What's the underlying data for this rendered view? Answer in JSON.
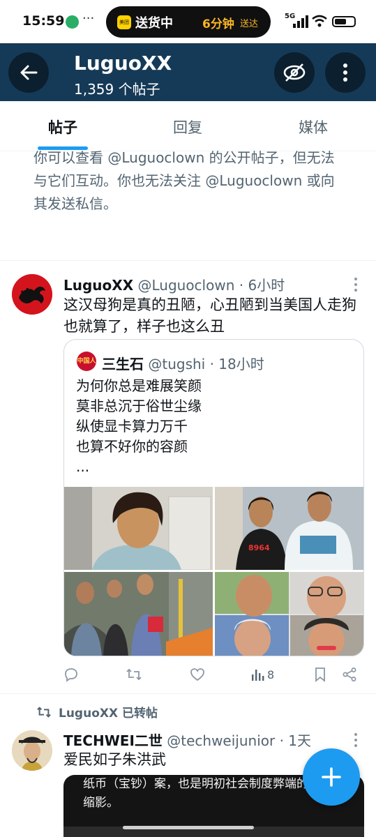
{
  "status_bar": {
    "time": "15:59",
    "dots": "···",
    "pill_app_icon": "美团",
    "pill_title": "送货中",
    "pill_eta": "6分钟",
    "pill_eta_suffix": "送达",
    "network": "5G"
  },
  "header": {
    "title": "LuguoXX",
    "subtitle": "1,359 个帖子"
  },
  "tabs": [
    {
      "label": "帖子",
      "active": true
    },
    {
      "label": "回复",
      "active": false
    },
    {
      "label": "媒体",
      "active": false
    }
  ],
  "notice": {
    "text": "你可以查看 @Luguoclown 的公开帖子，但无法与它们互动。你也无法关注 @Luguoclown 或向其发送私信。"
  },
  "tweet1": {
    "name": "LuguoXX",
    "handle": "@Luguoclown",
    "time": "· 6小时",
    "text": "这汉母狗是真的丑陋，心丑陋到当美国人走狗也就算了，样子也这么丑",
    "quote": {
      "avatar_text": "中国人",
      "name": "三生石",
      "handle": "@tugshi",
      "time": "· 18小时",
      "lines": [
        "为何你总是难展笑颜",
        "莫非总沉于俗世尘缘",
        "纵使显卡算力万千",
        "也算不好你的容颜",
        "..."
      ],
      "shirt_text": "8964"
    },
    "actions": {
      "views": "8"
    }
  },
  "retweet": {
    "label": "LuguoXX 已转帖"
  },
  "tweet2": {
    "name": "TECHWEI二世",
    "handle": "@techweijunior",
    "time": "· 1天",
    "text": "爱民如子朱洪武",
    "media_caption": "纸币（宝钞）案，也是明初社会制度弊端的典型缩影。"
  },
  "colors": {
    "accent": "#1d9bf0",
    "header_bg": "#153a57",
    "secondary_text": "#536471"
  }
}
